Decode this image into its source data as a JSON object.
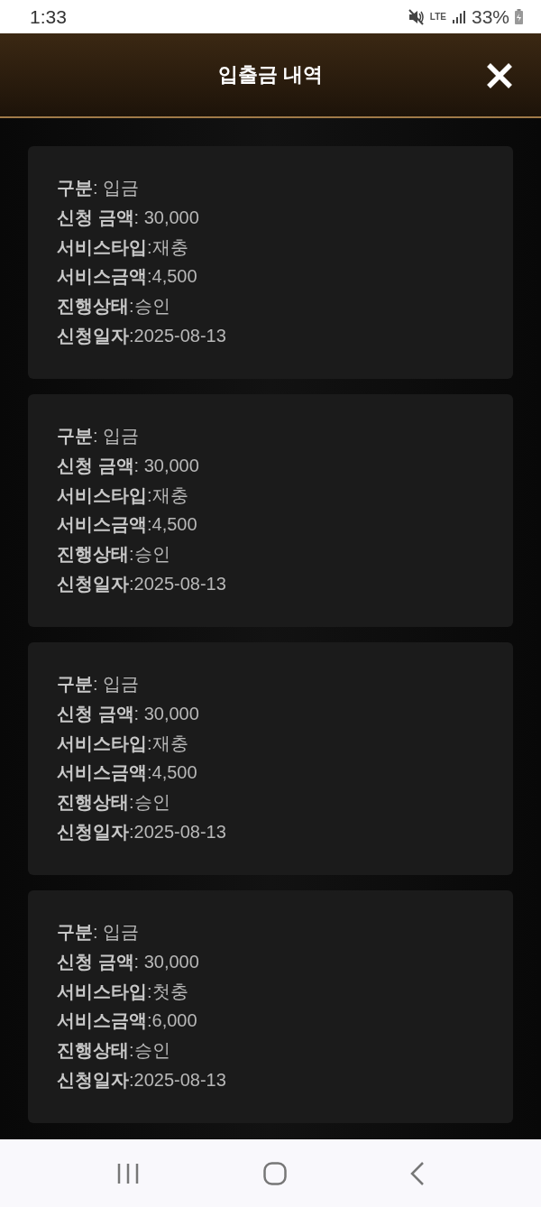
{
  "status_bar": {
    "time": "1:33",
    "network": "LTE",
    "battery": "33%"
  },
  "header": {
    "title": "입출금 내역"
  },
  "records": [
    {
      "lines": [
        "**구분**: 입금",
        "**신청 금액**: 30,000",
        "**서비스타입**:재충",
        "**서비스금액**:4,500",
        "**진행상태**:승인",
        "**신청일자**:2025-08-13"
      ]
    },
    {
      "lines": [
        "**구분**: 입금",
        "**신청 금액**: 30,000",
        "**서비스타입**:재충",
        "**서비스금액**:4,500",
        "**진행상태**:승인",
        "**신청일자**:2025-08-13"
      ]
    },
    {
      "lines": [
        "**구분**: 입금",
        "**신청 금액**: 30,000",
        "**서비스타입**:재충",
        "**서비스금액**:4,500",
        "**진행상태**:승인",
        "**신청일자**:2025-08-13"
      ]
    },
    {
      "lines": [
        "**구분**: 입금",
        "**신청 금액**: 30,000",
        "**서비스타입**:첫충",
        "**서비스금액**:6,000",
        "**진행상태**:승인",
        "**신청일자**:2025-08-13"
      ]
    }
  ]
}
